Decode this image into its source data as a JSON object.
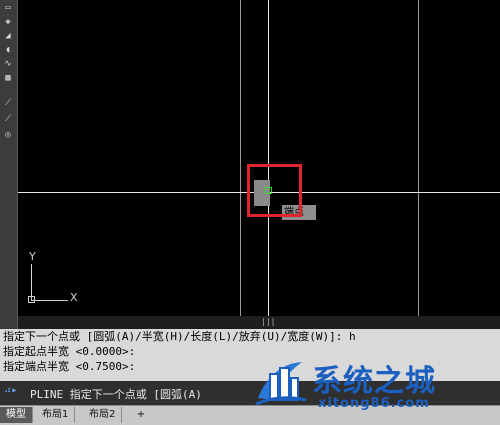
{
  "toolbar": {
    "tools": [
      "rectangle-icon",
      "revcloud-icon",
      "region-icon",
      "arc-region-icon",
      "spline-icon",
      "insert-block-icon",
      "line-edit-icon",
      "polyline-edit-icon",
      "circle-icon"
    ]
  },
  "canvas": {
    "snap_tooltip": "端点",
    "ucs": {
      "x_label": "X",
      "y_label": "Y"
    },
    "highlight_color": "#e0262c",
    "snap_color": "#2fe02f"
  },
  "command_history": {
    "line1": "指定下一个点或 [圆弧(A)/半宽(H)/长度(L)/放弃(U)/宽度(W)]: h",
    "line2": "指定起点半宽 <0.0000>:",
    "line3": "指定端点半宽 <0.7500>:"
  },
  "command_line": {
    "prompt": "PLINE 指定下一个点或 [圆弧(A)"
  },
  "layout_tabs": {
    "items": [
      {
        "label": "模型",
        "active": true
      },
      {
        "label": "布局1",
        "active": false
      },
      {
        "label": "布局2",
        "active": false
      }
    ],
    "add_label": "+"
  },
  "watermark": {
    "title": "系统之城",
    "url": "xitong86.com"
  }
}
